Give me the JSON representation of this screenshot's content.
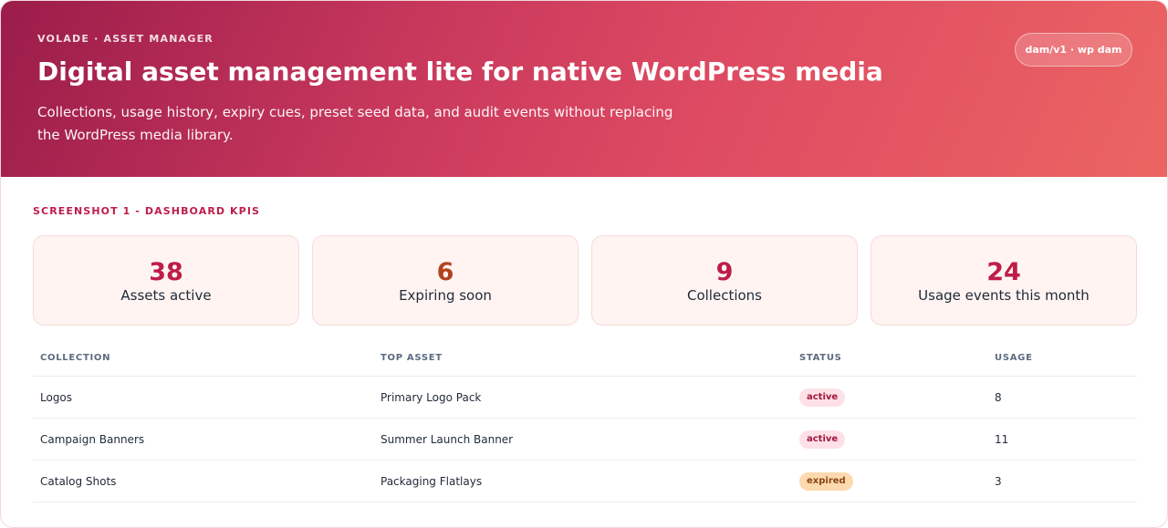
{
  "hero": {
    "eyebrow": "VOLADE · ASSET MANAGER",
    "title": "Digital asset management lite for native WordPress media",
    "description": "Collections, usage history, expiry cues, preset seed data, and audit events without replacing the WordPress media library.",
    "api_pill": "dam/v1 · wp dam"
  },
  "section_label": "SCREENSHOT 1 - DASHBOARD KPIS",
  "kpis": [
    {
      "value": "38",
      "label": "Assets active",
      "color": "#be1d48"
    },
    {
      "value": "6",
      "label": "Expiring soon",
      "color": "#b2431f"
    },
    {
      "value": "9",
      "label": "Collections",
      "color": "#be1d48"
    },
    {
      "value": "24",
      "label": "Usage events this month",
      "color": "#be1d48"
    }
  ],
  "table": {
    "headers": [
      "COLLECTION",
      "TOP ASSET",
      "STATUS",
      "USAGE"
    ],
    "rows": [
      {
        "collection": "Logos",
        "top_asset": "Primary Logo Pack",
        "status": "active",
        "usage": "8"
      },
      {
        "collection": "Campaign Banners",
        "top_asset": "Summer Launch Banner",
        "status": "active",
        "usage": "11"
      },
      {
        "collection": "Catalog Shots",
        "top_asset": "Packaging Flatlays",
        "status": "expired",
        "usage": "3"
      }
    ]
  }
}
